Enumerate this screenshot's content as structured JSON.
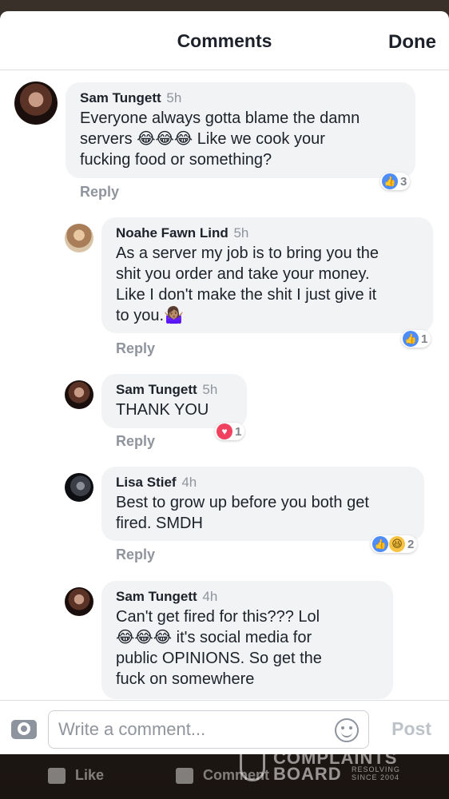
{
  "header": {
    "title": "Comments",
    "done_label": "Done"
  },
  "comments": [
    {
      "author": "Sam Tungett",
      "time": "5h",
      "text": "Everyone always gotta blame the damn\nservers 😂😂😂 Like we cook your\nfucking food or something?",
      "reply_label": "Reply",
      "reaction_count": "3"
    },
    {
      "author": "Noahe Fawn Lind",
      "time": "5h",
      "text": "As a server my job is to bring you the\nshit you order and take your money.\nLike I don't make the shit I just give it\nto you.🤷🏽‍♀️",
      "reply_label": "Reply",
      "reaction_count": "1"
    },
    {
      "author": "Sam Tungett",
      "time": "5h",
      "text": "THANK YOU",
      "reply_label": "Reply",
      "reaction_count": "1"
    },
    {
      "author": "Lisa Stief",
      "time": "4h",
      "text": "Best to grow up before you both get\nfired.  SMDH",
      "reply_label": "Reply",
      "reaction_count": "2"
    },
    {
      "author": "Sam Tungett",
      "time": "4h",
      "text": "Can't get fired for this??? Lol\n😂😂😂 it's social media for\npublic OPINIONS. So get the\nfuck on somewhere"
    }
  ],
  "composer": {
    "placeholder": "Write a comment...",
    "post_label": "Post"
  },
  "bottom_bar": {
    "like_label": "Like",
    "comment_label": "Comment"
  },
  "watermark": {
    "line1": "COMPLAINTS",
    "line2": "BOARD",
    "tagline": "RESOLVING",
    "since": "SINCE 2004"
  },
  "colors": {
    "like_blue": "#4e8cf7",
    "love_red": "#f0425f",
    "bubble_gray": "#f2f3f5"
  },
  "icons": [
    "camera-icon",
    "smiley-icon",
    "like-reaction-icon",
    "love-reaction-icon",
    "haha-reaction-icon"
  ]
}
